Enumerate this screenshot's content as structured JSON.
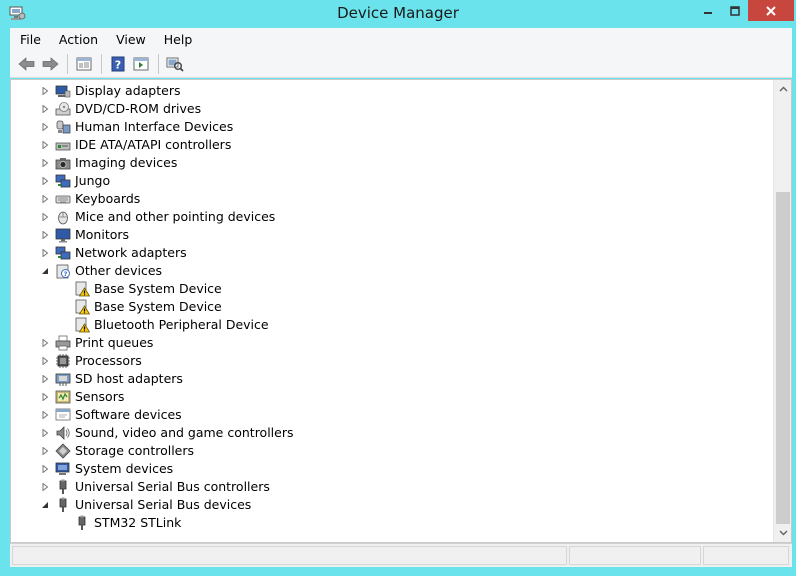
{
  "window": {
    "title": "Device Manager"
  },
  "menu": {
    "items": [
      "File",
      "Action",
      "View",
      "Help"
    ]
  },
  "toolbar": {
    "buttons": [
      "back-arrow-icon",
      "forward-arrow-icon",
      "properties-pane-icon",
      "help-icon",
      "console-tree-icon",
      "scan-hardware-icon"
    ]
  },
  "tree": {
    "items": [
      {
        "label": "Display adapters",
        "level": 1,
        "expanded": false,
        "icon": "display-adapter-icon"
      },
      {
        "label": "DVD/CD-ROM drives",
        "level": 1,
        "expanded": false,
        "icon": "dvd-drive-icon"
      },
      {
        "label": "Human Interface Devices",
        "level": 1,
        "expanded": false,
        "icon": "hid-icon"
      },
      {
        "label": "IDE ATA/ATAPI controllers",
        "level": 1,
        "expanded": false,
        "icon": "ide-controller-icon"
      },
      {
        "label": "Imaging devices",
        "level": 1,
        "expanded": false,
        "icon": "camera-icon"
      },
      {
        "label": "Jungo",
        "level": 1,
        "expanded": false,
        "icon": "network-device-icon"
      },
      {
        "label": "Keyboards",
        "level": 1,
        "expanded": false,
        "icon": "keyboard-icon"
      },
      {
        "label": "Mice and other pointing devices",
        "level": 1,
        "expanded": false,
        "icon": "mouse-icon"
      },
      {
        "label": "Monitors",
        "level": 1,
        "expanded": false,
        "icon": "monitor-icon"
      },
      {
        "label": "Network adapters",
        "level": 1,
        "expanded": false,
        "icon": "network-adapter-icon"
      },
      {
        "label": "Other devices",
        "level": 1,
        "expanded": true,
        "icon": "unknown-device-icon"
      },
      {
        "label": "Base System Device",
        "level": 2,
        "icon": "warning-device-icon"
      },
      {
        "label": "Base System Device",
        "level": 2,
        "icon": "warning-device-icon"
      },
      {
        "label": "Bluetooth Peripheral Device",
        "level": 2,
        "icon": "warning-device-icon"
      },
      {
        "label": "Print queues",
        "level": 1,
        "expanded": false,
        "icon": "printer-icon"
      },
      {
        "label": "Processors",
        "level": 1,
        "expanded": false,
        "icon": "processor-icon"
      },
      {
        "label": "SD host adapters",
        "level": 1,
        "expanded": false,
        "icon": "sd-host-icon"
      },
      {
        "label": "Sensors",
        "level": 1,
        "expanded": false,
        "icon": "sensor-icon"
      },
      {
        "label": "Software devices",
        "level": 1,
        "expanded": false,
        "icon": "software-device-icon"
      },
      {
        "label": "Sound, video and game controllers",
        "level": 1,
        "expanded": false,
        "icon": "speaker-icon"
      },
      {
        "label": "Storage controllers",
        "level": 1,
        "expanded": false,
        "icon": "storage-controller-icon"
      },
      {
        "label": "System devices",
        "level": 1,
        "expanded": false,
        "icon": "system-device-icon"
      },
      {
        "label": "Universal Serial Bus controllers",
        "level": 1,
        "expanded": false,
        "icon": "usb-icon"
      },
      {
        "label": "Universal Serial Bus devices",
        "level": 1,
        "expanded": true,
        "icon": "usb-icon"
      },
      {
        "label": "STM32 STLink",
        "level": 2,
        "icon": "usb-icon"
      }
    ]
  },
  "colors": {
    "frame": "#6ae3ec",
    "close_button": "#c7463d",
    "content_bg": "#ffffff"
  }
}
